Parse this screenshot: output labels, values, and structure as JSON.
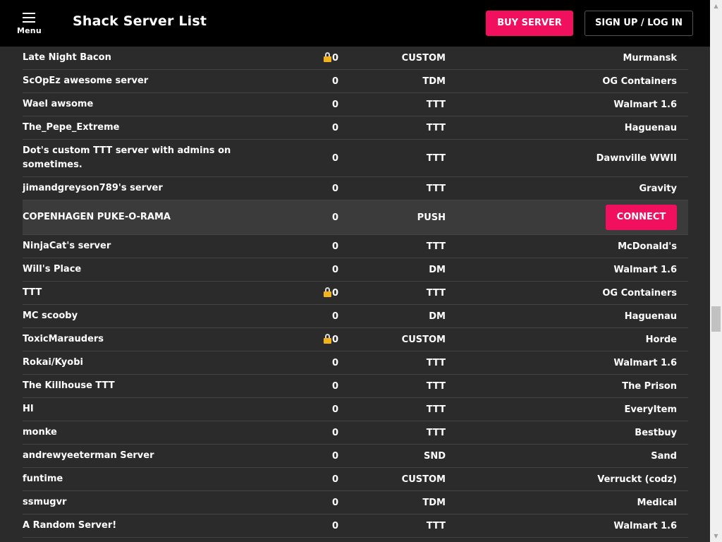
{
  "header": {
    "menu_label": "Menu",
    "title": "Shack Server List",
    "buy_label": "BUY SERVER",
    "login_label": "SIGN UP / LOG IN"
  },
  "colors": {
    "accent": "#f0105e",
    "lock": "#f2b21d",
    "background": "#2b2b2b",
    "header": "#000000"
  },
  "connect_label": "CONNECT",
  "servers": [
    {
      "name": "Late Night Bacon",
      "locked": true,
      "players": "0",
      "mode": "CUSTOM",
      "map": "Murmansk"
    },
    {
      "name": "ScOpEz awesome server",
      "locked": false,
      "players": "0",
      "mode": "TDM",
      "map": "OG Containers"
    },
    {
      "name": "Wael awsome",
      "locked": false,
      "players": "0",
      "mode": "TTT",
      "map": "Walmart 1.6"
    },
    {
      "name": "The_Pepe_Extreme",
      "locked": false,
      "players": "0",
      "mode": "TTT",
      "map": "Haguenau"
    },
    {
      "name": "Dot's custom TTT server with admins on sometimes.",
      "locked": false,
      "players": "0",
      "mode": "TTT",
      "map": "Dawnville WWII"
    },
    {
      "name": "jimandgreyson789's server",
      "locked": false,
      "players": "0",
      "mode": "TTT",
      "map": "Gravity"
    },
    {
      "name": "COPENHAGEN PUKE-O-RAMA",
      "locked": false,
      "players": "0",
      "mode": "PUSH",
      "map": "",
      "highlighted": true
    },
    {
      "name": "NinjaCat's server",
      "locked": false,
      "players": "0",
      "mode": "TTT",
      "map": "McDonald's"
    },
    {
      "name": "Will's Place",
      "locked": false,
      "players": "0",
      "mode": "DM",
      "map": "Walmart 1.6"
    },
    {
      "name": "TTT",
      "locked": true,
      "players": "0",
      "mode": "TTT",
      "map": "OG Containers"
    },
    {
      "name": "MC scooby",
      "locked": false,
      "players": "0",
      "mode": "DM",
      "map": "Haguenau"
    },
    {
      "name": "ToxicMarauders",
      "locked": true,
      "players": "0",
      "mode": "CUSTOM",
      "map": "Horde"
    },
    {
      "name": "Rokai/Kyobi",
      "locked": false,
      "players": "0",
      "mode": "TTT",
      "map": "Walmart 1.6"
    },
    {
      "name": "The Killhouse TTT",
      "locked": false,
      "players": "0",
      "mode": "TTT",
      "map": "The Prison"
    },
    {
      "name": "HI",
      "locked": false,
      "players": "0",
      "mode": "TTT",
      "map": "EveryItem"
    },
    {
      "name": "monke",
      "locked": false,
      "players": "0",
      "mode": "TTT",
      "map": "Bestbuy"
    },
    {
      "name": "andrewyeeterman Server",
      "locked": false,
      "players": "0",
      "mode": "SND",
      "map": "Sand"
    },
    {
      "name": "funtime",
      "locked": false,
      "players": "0",
      "mode": "CUSTOM",
      "map": "Verruckt (codz)"
    },
    {
      "name": "ssmugvr",
      "locked": false,
      "players": "0",
      "mode": "TDM",
      "map": "Medical"
    },
    {
      "name": "A Random Server!",
      "locked": false,
      "players": "0",
      "mode": "TTT",
      "map": "Walmart 1.6"
    }
  ]
}
